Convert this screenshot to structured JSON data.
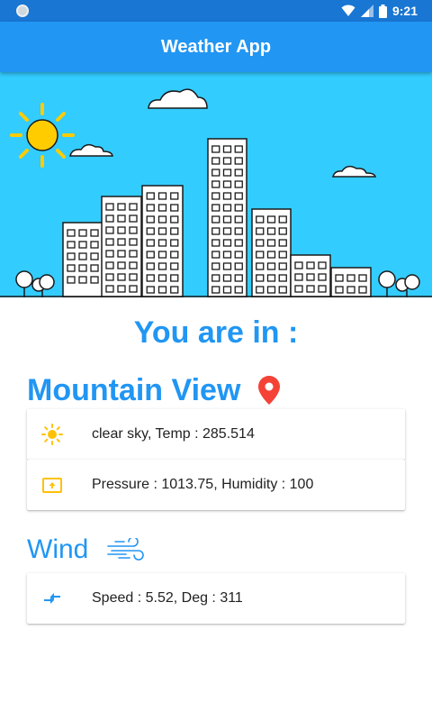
{
  "status_bar": {
    "time": "9:21"
  },
  "app_bar": {
    "title": "Weather App"
  },
  "main": {
    "heading": "You are in :",
    "city": "Mountain View",
    "weather_card": {
      "condition_text": "clear sky, Temp : 285.514",
      "pressure_text": "Pressure : 1013.75, Humidity : 100"
    },
    "wind_title": "Wind",
    "wind_card": {
      "speed_text": "Speed : 5.52, Deg : 311"
    }
  },
  "icons": {
    "location": "location-pin-icon",
    "sun": "sun-icon",
    "pressure": "pressure-icon",
    "wind": "wind-icon",
    "compress": "compress-arrows-icon"
  },
  "colors": {
    "status_bar": "#1976d2",
    "app_bar": "#2196f3",
    "accent": "#2196f3",
    "sky": "#33ccff",
    "pin": "#f44336",
    "sun": "#ffc107"
  }
}
